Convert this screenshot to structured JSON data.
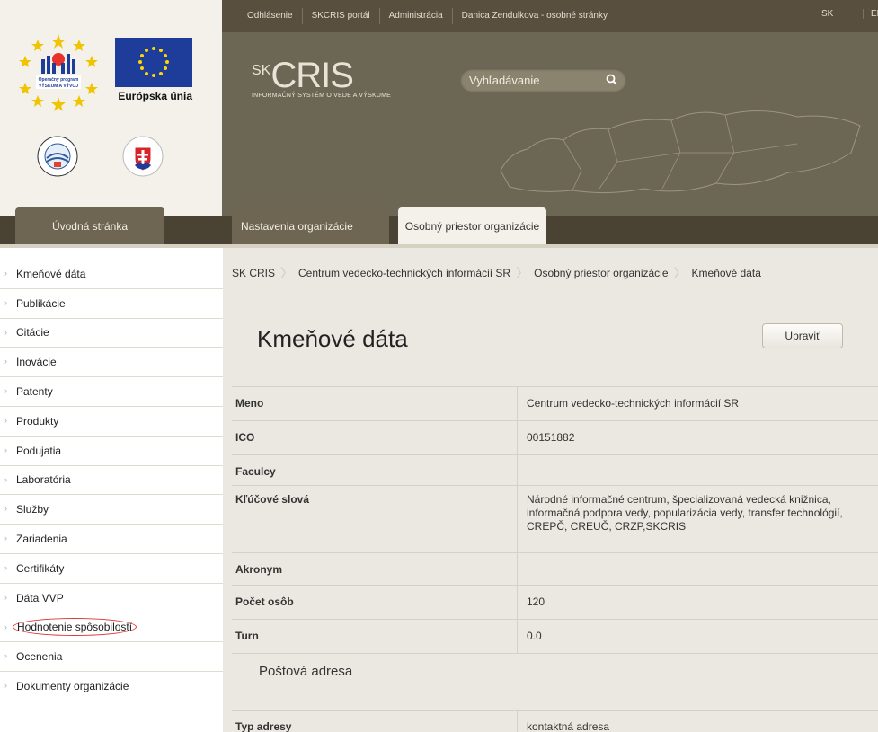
{
  "logos": {
    "operational_program_text": "Operačný program VÝSKUM A VÝVOJ",
    "eu_text": "Európska únia"
  },
  "topbar": {
    "links": [
      "Odhlásenie",
      "SKCRIS portál",
      "Administrácia",
      "Danica Zendulkova - osobné stránky"
    ],
    "lang_sk": "SK",
    "lang_en": "EN"
  },
  "brand": {
    "prefix": "SK",
    "name": "CRIS",
    "subtitle": "INFORMAČNÝ SYSTÉM O VEDE A VÝSKUME"
  },
  "search": {
    "placeholder": "Vyhľadávanie"
  },
  "tabs": {
    "home": "Úvodná stránka",
    "settings": "Nastavenia organizácie",
    "space": "Osobný priestor organizácie"
  },
  "sidebar": {
    "items": [
      {
        "label": "Kmeňové dáta"
      },
      {
        "label": "Publikácie"
      },
      {
        "label": "Citácie"
      },
      {
        "label": "Inovácie"
      },
      {
        "label": "Patenty"
      },
      {
        "label": "Produkty"
      },
      {
        "label": "Podujatia"
      },
      {
        "label": "Laboratória"
      },
      {
        "label": "Služby"
      },
      {
        "label": "Zariadenia"
      },
      {
        "label": "Certifikáty"
      },
      {
        "label": "Dáta VVP"
      },
      {
        "label": "Hodnotenie spôsobilostí"
      },
      {
        "label": "Ocenenia"
      },
      {
        "label": "Dokumenty organizácie"
      }
    ]
  },
  "breadcrumb": [
    "SK CRIS",
    "Centrum vedecko-technických informácií SR",
    "Osobný priestor organizácie",
    "Kmeňové dáta"
  ],
  "page": {
    "title": "Kmeňové dáta",
    "edit_label": "Upraviť"
  },
  "details": [
    {
      "key": "Meno",
      "value": "Centrum vedecko-technických informácií SR"
    },
    {
      "key": "ICO",
      "value": "00151882"
    },
    {
      "key": "Faculcy",
      "value": ""
    },
    {
      "key": "Kľúčové slová",
      "value": "Národné informačné centrum, špecializovaná vedecká knižnica, informačná podpora vedy, popularizácia vedy, transfer technológií, CREPČ, CREUČ, CRZP,SKCRIS"
    },
    {
      "key": "Akronym",
      "value": ""
    },
    {
      "key": "Počet osôb",
      "value": "120"
    },
    {
      "key": "Turn",
      "value": "0.0"
    }
  ],
  "postal": {
    "heading": "Poštová adresa",
    "type_key": "Typ adresy",
    "type_value": "kontaktná adresa"
  },
  "colors": {
    "header_bg": "#6c6654",
    "topbar_bg": "#584f3e",
    "content_bg": "#ebe8e1",
    "logo_panel_bg": "#f4f1ea",
    "highlight_circle": "#dd3333"
  }
}
